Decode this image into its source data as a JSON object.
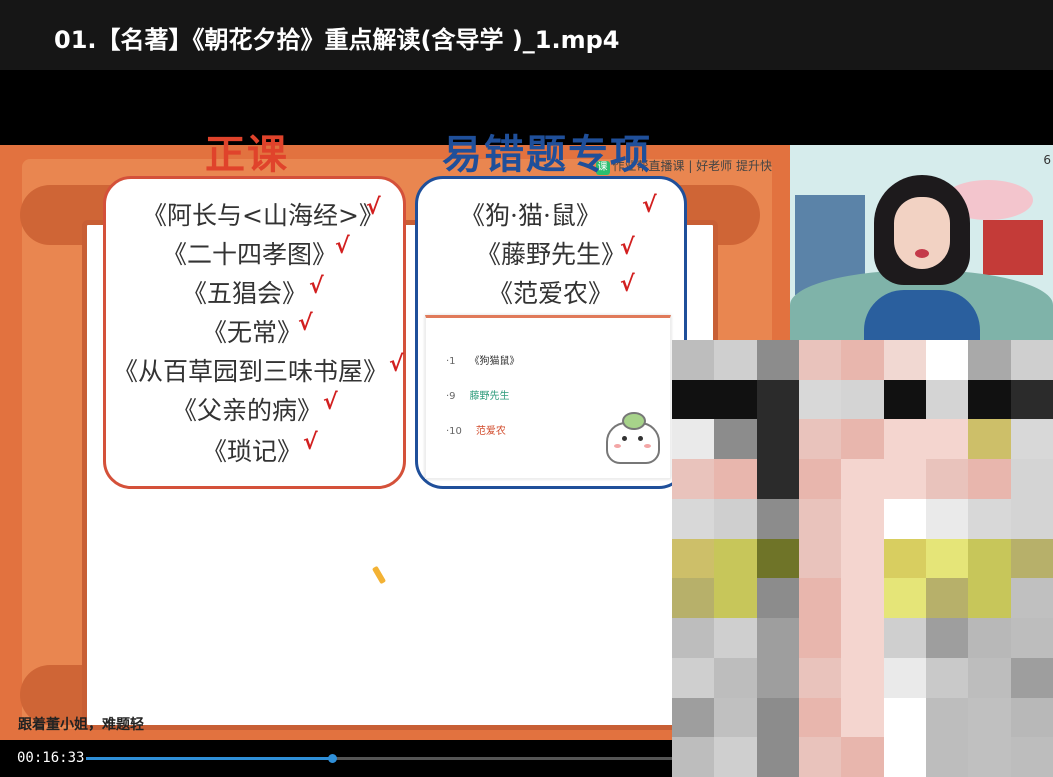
{
  "window": {
    "title": "01.【名著】《朝花夕拾》重点解读(含导学 )_1.mp4"
  },
  "slide": {
    "brand": {
      "logo_glyph": "课",
      "text": "作业帮直播课 | 好老师 提升快"
    },
    "left_heading": "正课",
    "right_heading": "易错题专项",
    "left_items": [
      "《阿长与<山海经>》",
      "《二十四孝图》",
      "《五猖会》",
      "《无常》",
      "《从百草园到三味书屋》",
      "《父亲的病》",
      "《琐记》"
    ],
    "right_items": [
      "《狗·猫·鼠》",
      "《藤野先生》",
      "《范爱农》"
    ],
    "check_glyph": "√",
    "card": {
      "rows": [
        {
          "num": "·1",
          "label": "《狗猫鼠》",
          "color": "#333333"
        },
        {
          "num": "·9",
          "label": "藤野先生",
          "color": "#2f9c7c"
        },
        {
          "num": "·10",
          "label": "范爱农",
          "color": "#d14a2a"
        }
      ]
    },
    "bottom_caption": "跟着董小姐，难题轻",
    "colors": {
      "accent_red": "#e0432b",
      "accent_blue": "#1f4f9a",
      "frame_orange": "#e2723f"
    }
  },
  "camera": {
    "corner_glyph": "6"
  },
  "player": {
    "current_time": "00:16:33",
    "progress": 0.42
  }
}
